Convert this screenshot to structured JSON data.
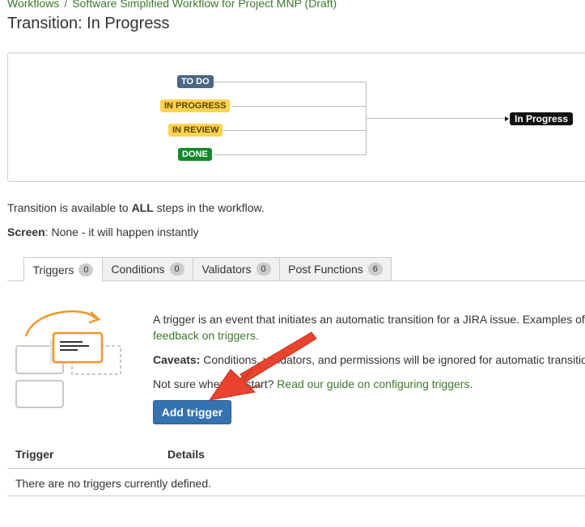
{
  "breadcrumb": {
    "items": [
      "Workflows",
      "Software Simplified Workflow for Project MNP (Draft)"
    ],
    "separator": "/"
  },
  "title": "Transition: In Progress",
  "diagram": {
    "statuses": [
      {
        "label": "TO DO",
        "color": "#4a6785"
      },
      {
        "label": "IN PROGRESS",
        "color": "#ffd351"
      },
      {
        "label": "IN REVIEW",
        "color": "#ffd351"
      },
      {
        "label": "DONE",
        "color": "#14892c"
      }
    ],
    "target": "In Progress"
  },
  "info": {
    "availability_pre": "Transition is available to ",
    "availability_bold": "ALL",
    "availability_post": " steps in the workflow.",
    "screen_label": "Screen",
    "screen_value": ": None - it will happen instantly"
  },
  "tabs": [
    {
      "label": "Triggers",
      "count": "0",
      "active": true
    },
    {
      "label": "Conditions",
      "count": "0",
      "active": false
    },
    {
      "label": "Validators",
      "count": "0",
      "active": false
    },
    {
      "label": "Post Functions",
      "count": "6",
      "active": false
    }
  ],
  "triggers_panel": {
    "intro": "A trigger is an event that initiates an automatic transition for a JIRA issue. Examples of",
    "feedback_link": "feedback on triggers.",
    "caveats_label": "Caveats:",
    "caveats_text": " Conditions, validators, and permissions will be ignored for automatic transitio",
    "guide_pre": "Not sure where to start? ",
    "guide_link": "Read our guide on configuring triggers.",
    "add_button": "Add trigger"
  },
  "table": {
    "columns": [
      "Trigger",
      "Details"
    ],
    "empty_message": "There are no triggers currently defined."
  },
  "colors": {
    "link": "#3b7a2b",
    "primary_button": "#3572b0",
    "annotation_arrow": "#e8432e",
    "illustration_accent": "#f0962a"
  }
}
